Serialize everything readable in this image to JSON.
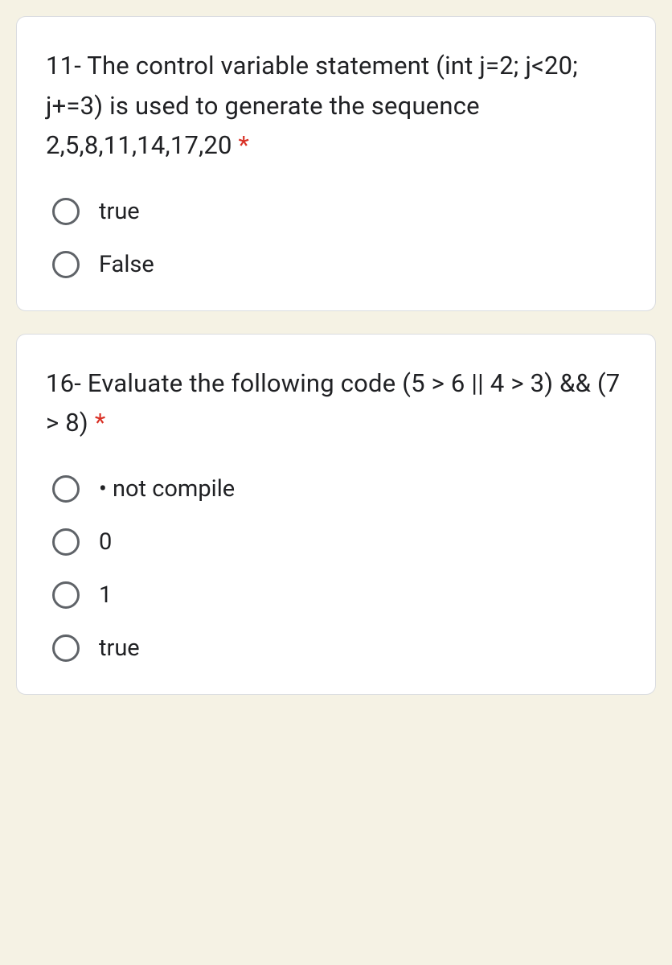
{
  "questions": [
    {
      "text": "11- The control variable statement (int j=2; j<20; j+=3) is used to generate the sequence 2,5,8,11,14,17,20 ",
      "required": "*",
      "options": [
        "true",
        "False"
      ]
    },
    {
      "text": "16- Evaluate the following code (5 > 6 || 4 > 3) && (7 > 8) ",
      "required": "*",
      "options": [
        "• not compile",
        "0",
        "1",
        "true"
      ]
    }
  ]
}
